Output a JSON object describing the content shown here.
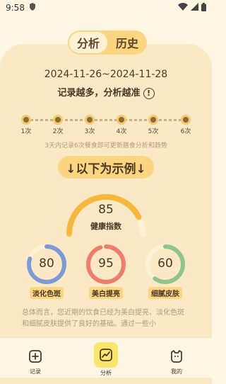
{
  "status_bar": {
    "time": "9:58"
  },
  "tabs": [
    {
      "label": "分析"
    },
    {
      "label": "历史"
    }
  ],
  "date_range": "2024-11-26~2024-11-28",
  "tagline": "记录越多，分析越准",
  "info_icon_glyph": "!",
  "timeline": {
    "labels": [
      "1次",
      "2次",
      "3次",
      "4次",
      "5次",
      "6次"
    ]
  },
  "hint": "3天内记录6次餐食即可更新膳食分析和趋势",
  "example_button": "↓以下为示例↓",
  "health_index": {
    "value": "85",
    "label": "健康指数",
    "fraction": 0.85,
    "color": "#f6b73c"
  },
  "metrics": [
    {
      "value": "80",
      "label": "淡化色斑",
      "fraction": 0.8,
      "color": "#7d9ad6"
    },
    {
      "value": "95",
      "label": "美白提亮",
      "fraction": 0.95,
      "color": "#ef7d6b"
    },
    {
      "value": "60",
      "label": "细腻皮肤",
      "fraction": 0.6,
      "color": "#8fc58a"
    }
  ],
  "summary": "总体而言，您近期的饮食已经为美白提亮、淡化色斑和细腻皮肤提供了良好的基础。通过一些小",
  "nav": [
    {
      "label": "记录",
      "icon": "plus-square-icon"
    },
    {
      "label": "分析",
      "icon": "chart-icon"
    },
    {
      "label": "我的",
      "icon": "profile-icon"
    }
  ],
  "colors": {
    "accent": "#fbd580",
    "card": "#fbe9c6",
    "background": "#fdf6e3",
    "active_nav": "#fbe56a"
  }
}
